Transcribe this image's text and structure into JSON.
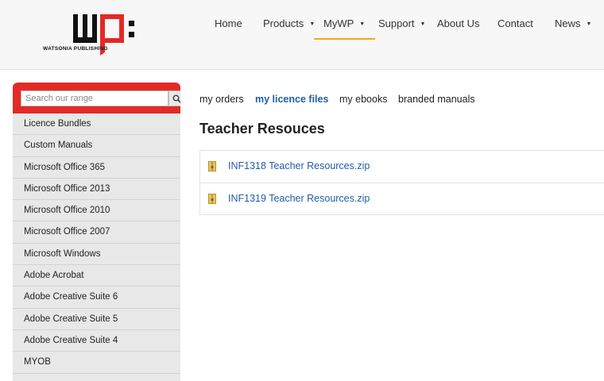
{
  "brand": {
    "name": "WATSONIA PUBLISHING",
    "logo_letters": "wp:"
  },
  "nav": {
    "items": [
      {
        "label": "Home",
        "has_dropdown": false
      },
      {
        "label": "Products",
        "has_dropdown": true
      },
      {
        "label": "MyWP",
        "has_dropdown": true,
        "active": true
      },
      {
        "label": "Support",
        "has_dropdown": true
      },
      {
        "label": "About Us",
        "has_dropdown": false
      },
      {
        "label": "Contact",
        "has_dropdown": false
      },
      {
        "label": "News",
        "has_dropdown": true
      }
    ],
    "dropdown_glyph": "▼"
  },
  "sidebar": {
    "search_placeholder": "Search our range",
    "items": [
      {
        "label": "Licence Bundles"
      },
      {
        "label": "Custom Manuals"
      },
      {
        "label": "Microsoft Office 365"
      },
      {
        "label": "Microsoft Office 2013"
      },
      {
        "label": "Microsoft Office 2010"
      },
      {
        "label": "Microsoft Office 2007"
      },
      {
        "label": "Microsoft Windows"
      },
      {
        "label": "Adobe Acrobat"
      },
      {
        "label": "Adobe Creative Suite 6"
      },
      {
        "label": "Adobe Creative Suite 5"
      },
      {
        "label": "Adobe Creative Suite 4"
      },
      {
        "label": "MYOB"
      }
    ]
  },
  "main": {
    "tabs": [
      {
        "label": "my orders"
      },
      {
        "label": "my licence files",
        "active": true
      },
      {
        "label": "my ebooks"
      },
      {
        "label": "branded manuals"
      }
    ],
    "title": "Teacher Resouces",
    "files": [
      {
        "name": "INF1318 Teacher Resources.zip",
        "icon": "zip-file-icon"
      },
      {
        "name": "INF1319 Teacher Resources.zip",
        "icon": "zip-file-icon"
      }
    ]
  },
  "colors": {
    "brand_red": "#e32a26",
    "link_blue": "#1f5ea8",
    "active_underline": "#f5a623"
  }
}
